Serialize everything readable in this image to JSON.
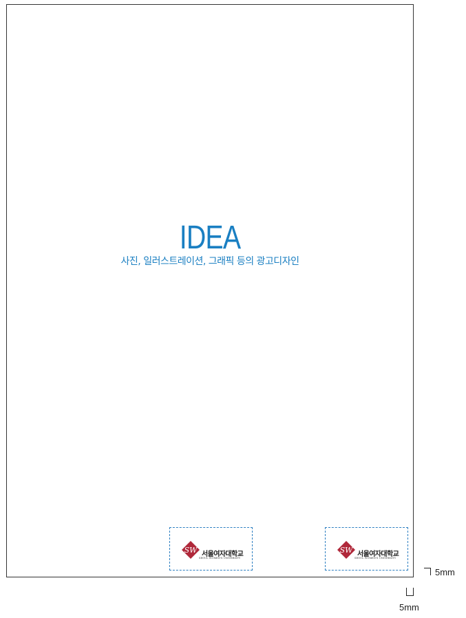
{
  "title": "IDEA",
  "subtitle": "사진, 일러스트레이션, 그래픽 등의 광고디자인",
  "logos": [
    {
      "name": "서울여자대학교",
      "english": "SEOUL WOMEN'S UNIVERSITY",
      "emblem_letters": "SW"
    },
    {
      "name": "서울여자대학교",
      "english": "SEOUL WOMEN'S UNIVERSITY",
      "emblem_letters": "SW"
    }
  ],
  "margins": {
    "right_label": "5mm",
    "bottom_label": "5mm"
  },
  "colors": {
    "accent": "#1a7fc2",
    "emblem": "#b0283a",
    "dashed_border": "#2b7ec1"
  }
}
